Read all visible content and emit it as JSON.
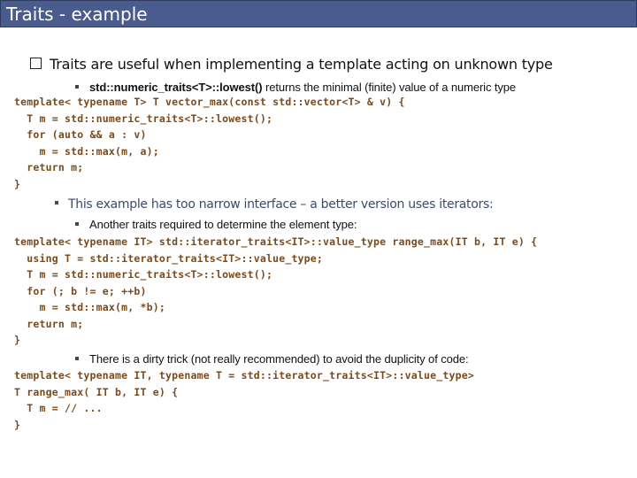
{
  "title": "Traits - example",
  "colors": {
    "title_bar": "#4a5c8e",
    "code": "#7b4a1b",
    "subbullet": "#3d4a6b"
  },
  "intro": {
    "bullet_icon": "checkbox-square-icon",
    "text": "Traits are useful when implementing a template acting on unknown type"
  },
  "point1": {
    "bold": "std::numeric_traits<T>::lowest()",
    "rest": " returns the minimal (finite) value of a numeric type"
  },
  "code1": [
    "template< typename T> T vector_max(const std::vector<T> & v) {",
    "  T m = std::numeric_traits<T>::lowest();",
    "  for (auto && a : v)",
    "    m = std::max(m, a);",
    "  return m;",
    "}"
  ],
  "point2": "This example has too narrow interface – a better version uses iterators:",
  "point3": "Another traits required to determine the element type:",
  "code2": [
    "template< typename IT> std::iterator_traits<IT>::value_type range_max(IT b, IT e) {",
    "  using T = std::iterator_traits<IT>::value_type;",
    "  T m = std::numeric_traits<T>::lowest();",
    "  for (; b != e; ++b)",
    "    m = std::max(m, *b);",
    "  return m;",
    "}"
  ],
  "point4": "There is a dirty trick (not really recommended) to avoid the duplicity of code:",
  "code3": [
    "template< typename IT, typename T = std::iterator_traits<IT>::value_type>",
    "T range_max( IT b, IT e) {",
    "  T m = // ...",
    "}"
  ]
}
